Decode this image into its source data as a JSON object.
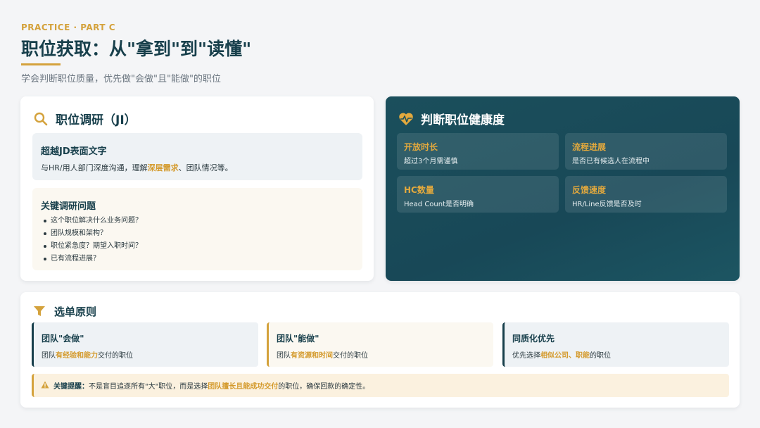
{
  "header": {
    "eyebrow": "PRACTICE · PART C",
    "title": "职位获取：从\"拿到\"到\"读懂\"",
    "subtitle": "学会判断职位质量，优先做\"会做\"且\"能做\"的职位"
  },
  "research": {
    "title": "职位调研（JI）",
    "panel_a": {
      "title": "超越JD表面文字",
      "text_before": "与HR/用人部门深度沟通，理解",
      "text_highlight": "深层需求",
      "text_after": "、团队情况等。"
    },
    "panel_b": {
      "title": "关键调研问题",
      "questions": [
        "这个职位解决什么业务问题？",
        "团队规模和架构？",
        "职位紧急度？期望入职时间？",
        "已有流程进展？"
      ]
    }
  },
  "health": {
    "title": "判断职位健康度",
    "metrics": [
      {
        "title": "开放时长",
        "text": "超过3个月需谨慎"
      },
      {
        "title": "流程进展",
        "text": "是否已有候选人在流程中"
      },
      {
        "title": "HC数量",
        "text": "Head Count是否明确"
      },
      {
        "title": "反馈速度",
        "text": "HR/Line反馈是否及时"
      }
    ]
  },
  "principles": {
    "title": "选单原则",
    "items": [
      {
        "title": "团队\"会做\"",
        "before": "团队",
        "highlight": "有经验和能力",
        "after": "交付的职位"
      },
      {
        "title": "团队\"能做\"",
        "before": "团队",
        "highlight": "有资源和时间",
        "after": "交付的职位"
      },
      {
        "title": "同质化优先",
        "before": "优先选择",
        "highlight": "相似公司、职能",
        "after": "的职位"
      }
    ],
    "tip": {
      "label": "关键提醒：",
      "before": "不是盲目追逐所有\"大\"职位，而是选择",
      "highlight": "团队擅长且能成功交付",
      "after": "的职位，确保回款的确定性。"
    }
  },
  "colors": {
    "accent": "#d4a23c",
    "primary": "#173f4b",
    "teal_card": "#1b4f5c"
  },
  "icons": {
    "research": "search-icon",
    "health": "heartbeat-icon",
    "principles": "filter-icon",
    "tip": "warning-icon"
  }
}
